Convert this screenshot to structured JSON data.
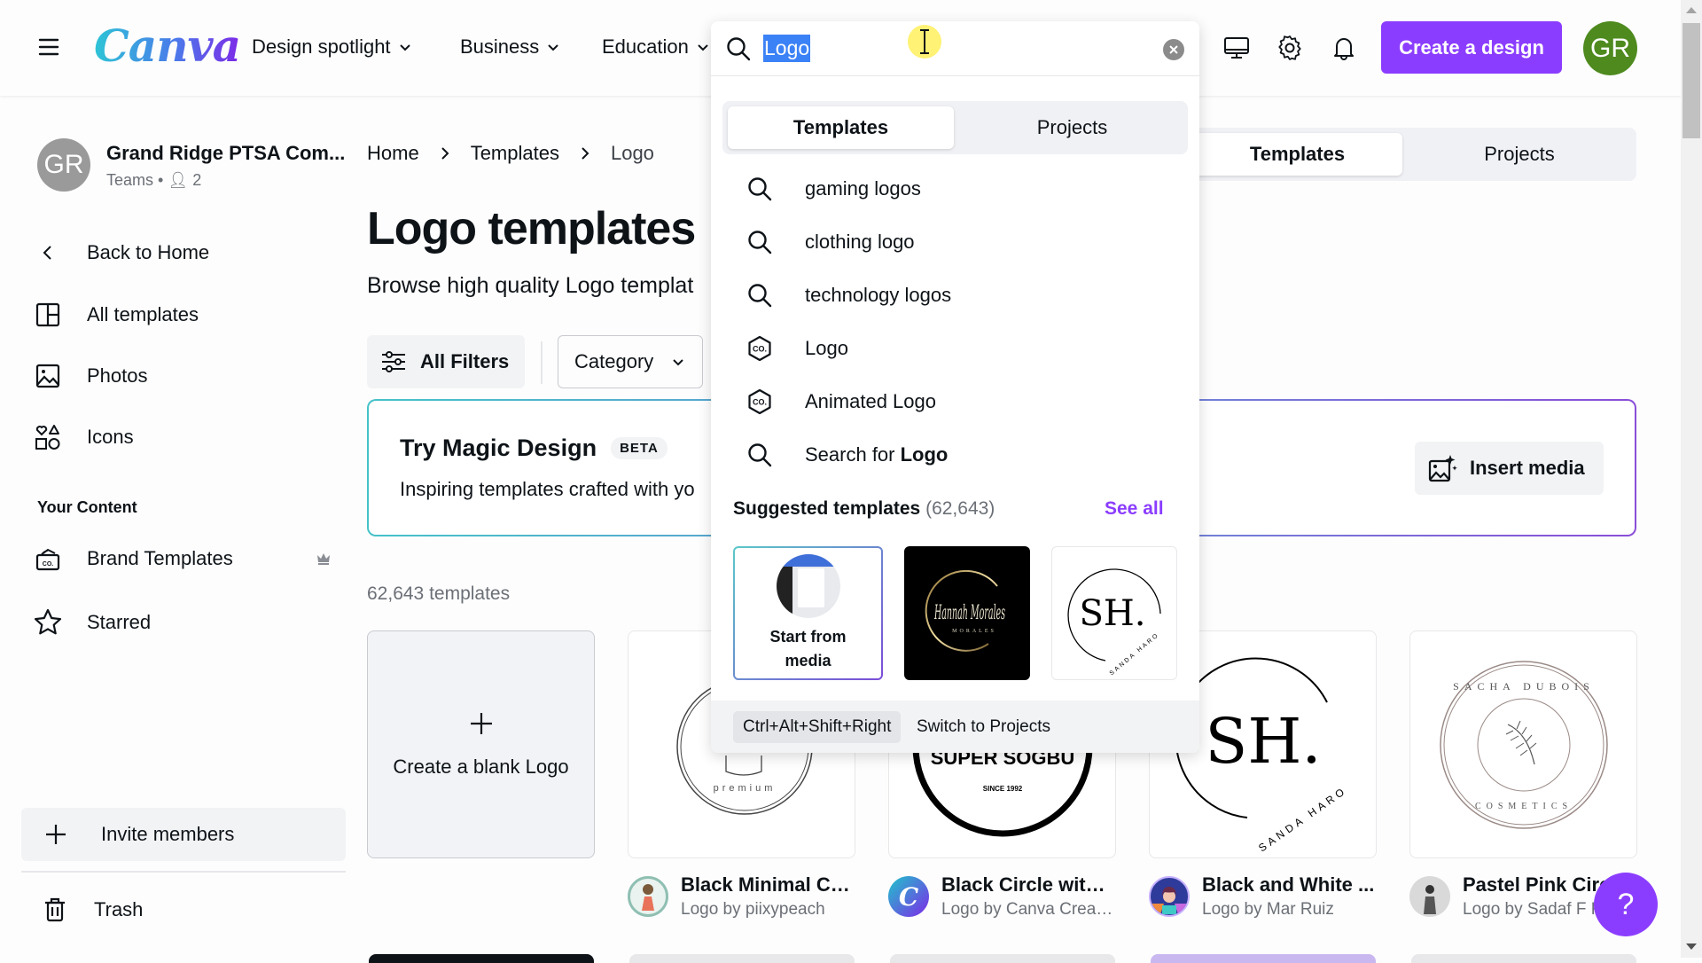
{
  "header": {
    "brand": "Canva",
    "nav": [
      {
        "label": "Design spotlight"
      },
      {
        "label": "Business"
      },
      {
        "label": "Education"
      }
    ],
    "icons": [
      "monitor-icon",
      "gear-icon",
      "bell-icon"
    ],
    "create_button": "Create a design",
    "user_initials": "GR",
    "accent_color": "#8b3dff"
  },
  "search": {
    "value": "Logo",
    "tabs": [
      {
        "label": "Templates",
        "active": true
      },
      {
        "label": "Projects",
        "active": false
      }
    ],
    "suggestions": [
      {
        "icon": "search-icon",
        "label": "gaming logos"
      },
      {
        "icon": "search-icon",
        "label": "clothing logo"
      },
      {
        "icon": "search-icon",
        "label": "technology logos"
      },
      {
        "icon": "design-type-icon",
        "label": "Logo"
      },
      {
        "icon": "design-type-icon",
        "label": "Animated Logo"
      }
    ],
    "search_for": {
      "prefix": "Search for ",
      "term": "Logo"
    },
    "suggested_templates": {
      "title": "Suggested templates",
      "count": "(62,643)",
      "see_all": "See all",
      "items": [
        {
          "label": "Start from media"
        },
        {
          "label": "Hannah Morales",
          "sub": "MORALES"
        },
        {
          "label": "SH.",
          "sub": "SANDA HARO"
        }
      ]
    },
    "footer": {
      "shortcut": "Ctrl+Alt+Shift+Right",
      "text": "Switch to Projects"
    }
  },
  "sidebar": {
    "team": {
      "initials": "GR",
      "name": "Grand Ridge PTSA Com...",
      "type": "Teams",
      "members": "2"
    },
    "back": "Back to Home",
    "items": [
      {
        "label": "All templates",
        "icon": "layout-icon"
      },
      {
        "label": "Photos",
        "icon": "image-icon"
      },
      {
        "label": "Icons",
        "icon": "shapes-icon"
      }
    ],
    "section_title": "Your Content",
    "content_items": [
      {
        "label": "Brand Templates",
        "icon": "brand-kit-icon",
        "premium": true
      },
      {
        "label": "Starred",
        "icon": "star-icon"
      }
    ],
    "invite": "Invite members",
    "trash": "Trash"
  },
  "main": {
    "breadcrumb": [
      "Home",
      "Templates",
      "Logo"
    ],
    "title": "Logo templates",
    "subtitle": "Browse high quality Logo templat",
    "all_filters": "All Filters",
    "category": "Category",
    "tabs": [
      {
        "label": "Templates",
        "active": true
      },
      {
        "label": "Projects",
        "active": false
      }
    ],
    "magic": {
      "title": "Try Magic Design",
      "badge": "BETA",
      "subtitle": "Inspiring templates crafted with yo",
      "insert_media": "Insert media"
    },
    "count": "62,643 templates",
    "blank_card": "Create a blank Logo",
    "templates": [
      {
        "title": "Black Minimal Ca...",
        "author": "Logo by piixypeach",
        "art_text": "premium"
      },
      {
        "title": "Black Circle with ...",
        "author": "Logo by Canva Creati...",
        "art_text": "SUPER SOGBU",
        "art_sub": "SINCE 1992"
      },
      {
        "title": "Black and White ...",
        "author": "Logo by Mar Ruiz",
        "art_text": "SH.",
        "art_sub": "SANDA HARO"
      },
      {
        "title": "Pastel Pink Circl",
        "author": "Logo by Sadaf F K",
        "art_text": "SACHA DUBOIS",
        "art_sub": "COSMETICS"
      }
    ],
    "help": "?"
  }
}
